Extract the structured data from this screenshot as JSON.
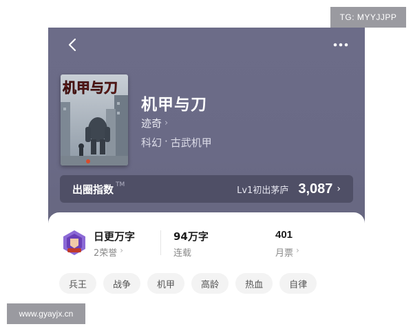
{
  "watermarks": {
    "top_right": "TG: MYYJJPP",
    "bottom_left": "www.gyayjx.cn"
  },
  "header": {
    "back_icon": "chevron-left-icon",
    "more_icon": "more-dots-icon"
  },
  "book": {
    "cover_title": "机甲与刀",
    "title": "机甲与刀",
    "author": "迹奇",
    "genre": "科幻",
    "separator": "·",
    "subgenre": "古武机甲"
  },
  "index_bar": {
    "label": "出圈指数",
    "tm": "TM",
    "level": "Lv1初出茅庐",
    "score": "3,087"
  },
  "stats": {
    "honor_title": "日更万字",
    "honor_sub": "2荣誉",
    "words_value": "94万字",
    "words_label": "连载",
    "tickets_value": "401",
    "tickets_label": "月票"
  },
  "tags": [
    "兵王",
    "战争",
    "机甲",
    "高龄",
    "热血",
    "自律"
  ],
  "colors": {
    "hero_bg": "#6c6c88",
    "index_bar_bg": "#4f4f66",
    "badge_accent": "#7a4fc4"
  }
}
